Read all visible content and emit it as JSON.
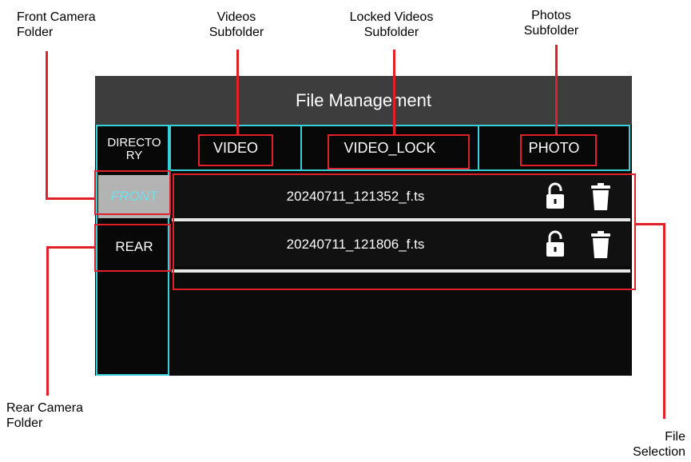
{
  "callouts": {
    "front_folder": "Front Camera\nFolder",
    "videos_subfolder": "Videos\nSubfolder",
    "locked_videos_subfolder": "Locked Videos\nSubfolder",
    "photos_subfolder": "Photos\nSubfolder",
    "rear_folder": "Rear Camera\nFolder",
    "file_selection": "File\nSelection"
  },
  "screen": {
    "title": "File Management",
    "directory_label": "DIRECTO\nRY",
    "folders": [
      "FRONT",
      "REAR"
    ],
    "tabs": [
      "VIDEO",
      "VIDEO_LOCK",
      "PHOTO"
    ],
    "files": [
      "20240711_121352_f.ts",
      "20240711_121806_f.ts"
    ]
  },
  "colors": {
    "accent_border": "#35cfd8",
    "annotation_red": "#e2202a",
    "title_bar": "#3d3d3d",
    "selected_folder": "#b3b3b3"
  },
  "icons": {
    "lock": "unlocked-padlock-icon",
    "delete": "trash-can-icon"
  }
}
